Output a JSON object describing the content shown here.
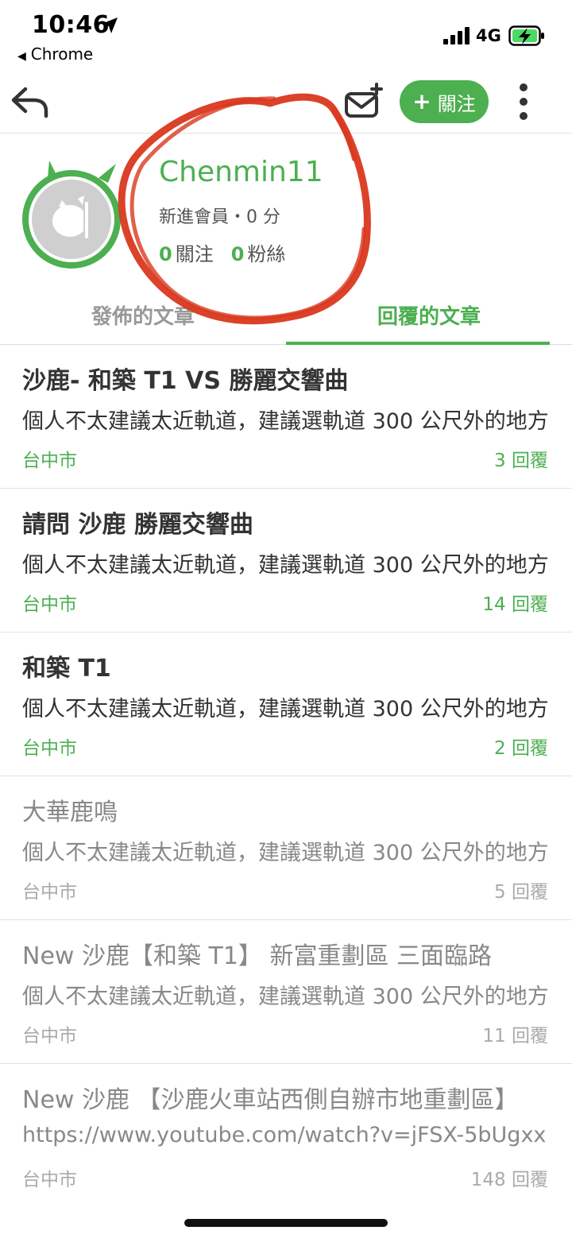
{
  "status_bar": {
    "time": "10:46",
    "back_app": "Chrome",
    "network": "4G"
  },
  "nav": {
    "follow_label": "關注",
    "follow_plus": "+"
  },
  "profile": {
    "username": "Chenmin11",
    "rank": "新進會員・0 分",
    "following_count": "0",
    "following_label": "關注",
    "followers_count": "0",
    "followers_label": "粉絲"
  },
  "tabs": {
    "posts": "發佈的文章",
    "replies": "回覆的文章"
  },
  "posts": [
    {
      "title": "沙鹿- 和築 T1 VS 勝麗交響曲",
      "excerpt": "個人不太建議太近軌道，建議選軌道 300 公尺外的地方",
      "location": "台中市",
      "replies": "3 回覆"
    },
    {
      "title": "請問 沙鹿 勝麗交響曲",
      "excerpt": "個人不太建議太近軌道，建議選軌道 300 公尺外的地方",
      "location": "台中市",
      "replies": "14 回覆"
    },
    {
      "title": "和築 T1",
      "excerpt": "個人不太建議太近軌道，建議選軌道 300 公尺外的地方",
      "location": "台中市",
      "replies": "2 回覆"
    },
    {
      "title": "大華鹿鳴",
      "excerpt": "個人不太建議太近軌道，建議選軌道 300 公尺外的地方",
      "location": "台中市",
      "replies": "5 回覆"
    },
    {
      "title": "New 沙鹿【和築 T1】 新富重劃區 三面臨路",
      "excerpt": "個人不太建議太近軌道，建議選軌道 300 公尺外的地方",
      "location": "台中市",
      "replies": "11 回覆"
    },
    {
      "title": "New 沙鹿 【沙鹿火車站西側自辦市地重劃區】",
      "excerpt": "https://www.youtube.com/watch?v=jFSX-5bUgxx",
      "location": "台中市",
      "replies": "148 回覆"
    }
  ],
  "colors": {
    "accent": "#4caf50",
    "annotation": "#d9381e"
  }
}
